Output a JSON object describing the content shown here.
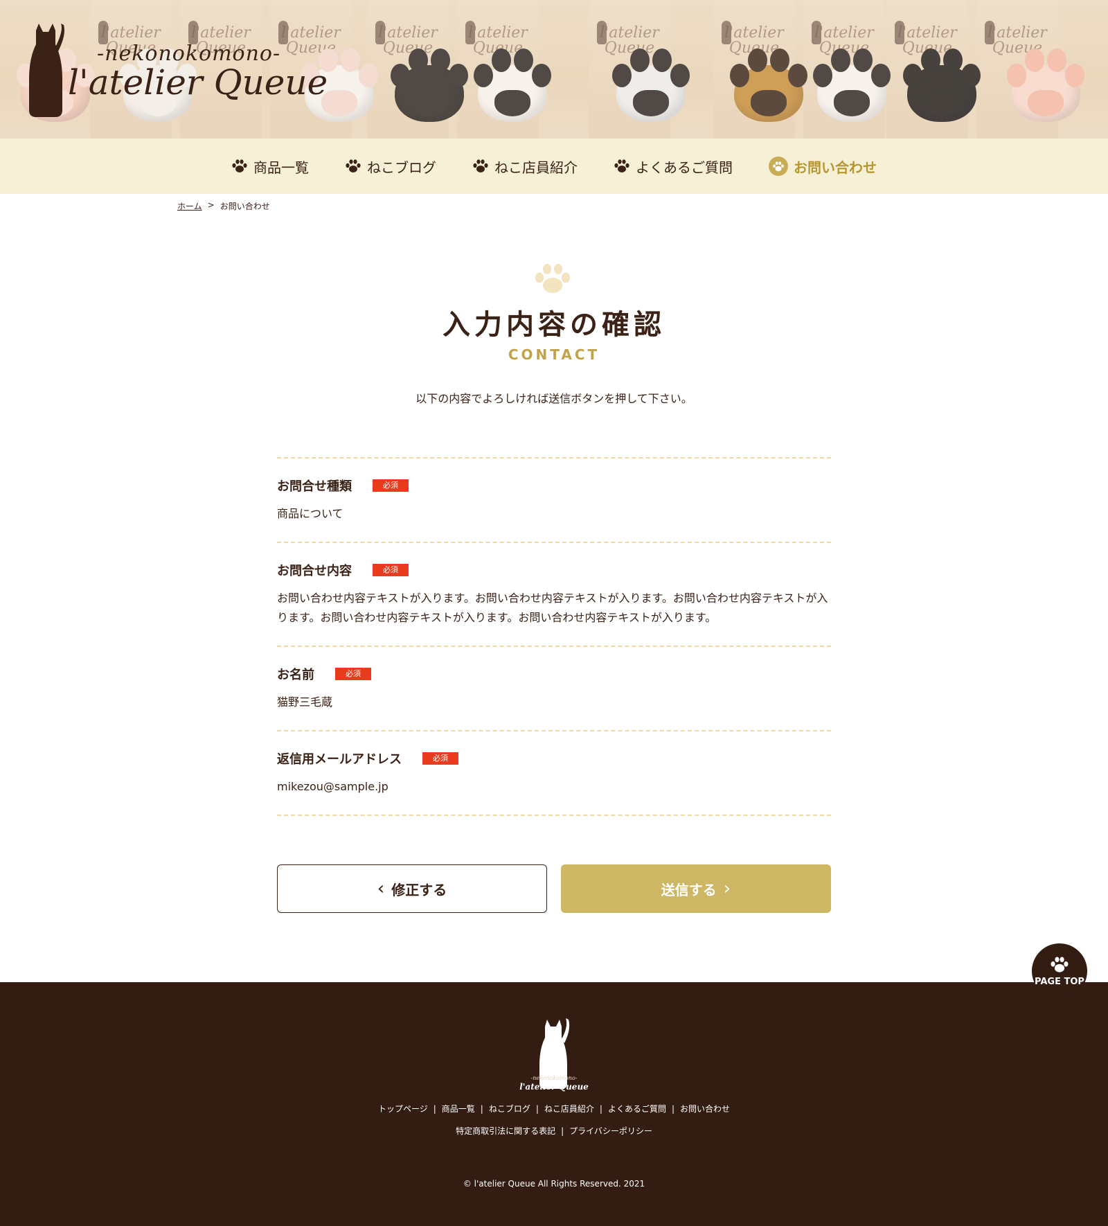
{
  "brand": {
    "tagline": "-nekonokomono-",
    "name": "l'atelier Queue",
    "bag_text_1": "l'atelier",
    "bag_text_2": "Queue"
  },
  "nav": {
    "items": [
      {
        "label": "商品一覧",
        "icon": "paw-icon"
      },
      {
        "label": "ねこブログ",
        "icon": "paw-icon"
      },
      {
        "label": "ねこ店員紹介",
        "icon": "paw-icon"
      },
      {
        "label": "よくあるご質問",
        "icon": "paw-icon"
      },
      {
        "label": "お問い合わせ",
        "icon": "paw-circle-icon",
        "active": true
      }
    ]
  },
  "breadcrumb": {
    "home": "ホーム",
    "separator": ">",
    "current": "お問い合わせ"
  },
  "page": {
    "title": "入力内容の確認",
    "subtitle": "CONTACT",
    "lead": "以下の内容でよろしければ送信ボタンを押して下さい。"
  },
  "fields": [
    {
      "label": "お問合せ種類",
      "required": "必須",
      "value": "商品について"
    },
    {
      "label": "お問合せ内容",
      "required": "必須",
      "value": "お問い合わせ内容テキストが入ります。お問い合わせ内容テキストが入ります。お問い合わせ内容テキストが入ります。お問い合わせ内容テキストが入ります。お問い合わせ内容テキストが入ります。"
    },
    {
      "label": "お名前",
      "required": "必須",
      "value": "猫野三毛蔵"
    },
    {
      "label": "返信用メールアドレス",
      "required": "必須",
      "value": "mikezou@sample.jp"
    }
  ],
  "buttons": {
    "back": "修正する",
    "send": "送信する",
    "back_chevron": "‹",
    "send_chevron": "›"
  },
  "page_top": {
    "label": "PAGE TOP"
  },
  "footer": {
    "logo_sub": "-nekonokomono-",
    "logo_main": "l'atelier Queue",
    "links1": [
      "トップページ",
      "商品一覧",
      "ねこブログ",
      "ねこ店員紹介",
      "よくあるご質問",
      "お問い合わせ"
    ],
    "links2": [
      "特定商取引法に関する表記",
      "プライバシーポリシー"
    ],
    "separator": "|",
    "copyright": "© l'atelier Queue All Rights Reserved. 2021"
  },
  "colors": {
    "brown": "#3a2216",
    "footer_bg": "#331c12",
    "nav_bg": "#f6f0d7",
    "gold": "#cdb764",
    "required": "#e83a1d",
    "dashed_line": "#efd9a2"
  }
}
